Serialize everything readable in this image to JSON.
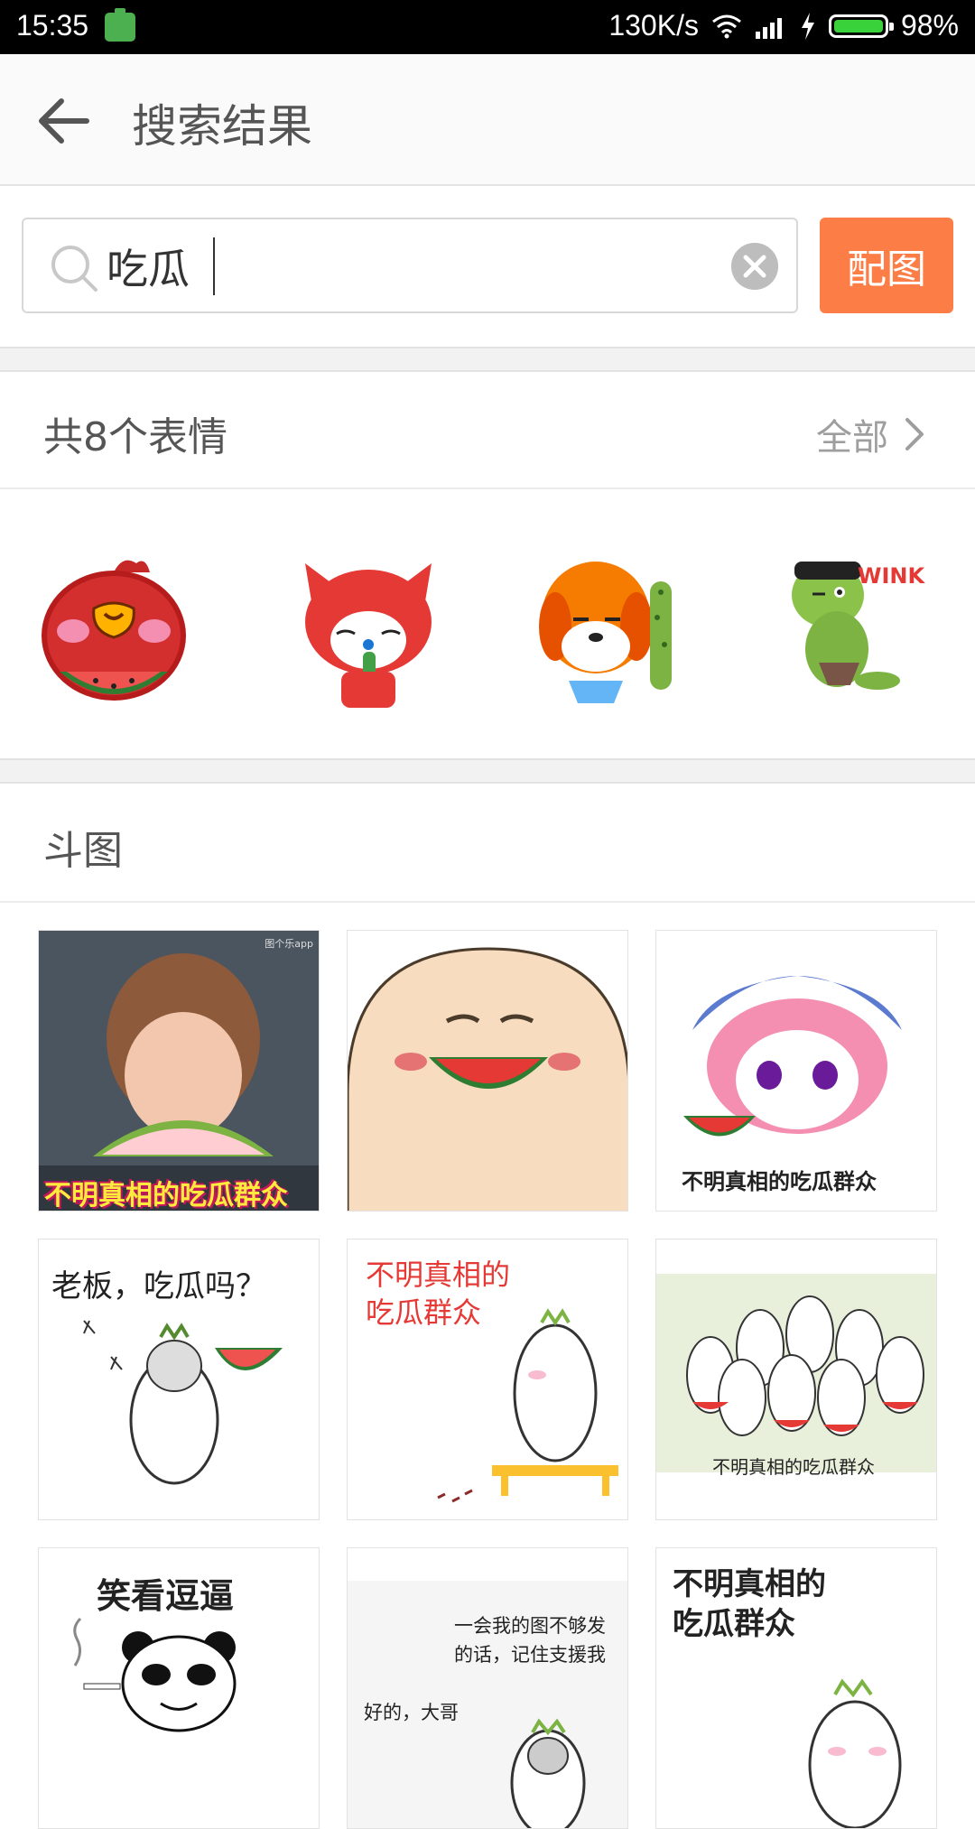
{
  "status_bar": {
    "time": "15:35",
    "net_speed": "130K/s",
    "battery": "98%",
    "icons": [
      "battery-saver-icon",
      "wifi-icon",
      "signal-icon",
      "charging-icon",
      "battery-icon"
    ]
  },
  "header": {
    "back_icon": "arrow-left-icon",
    "title": "搜索结果"
  },
  "search": {
    "value": "吃瓜",
    "icon": "search-icon",
    "clear_icon": "clear-icon",
    "button_label": "配图",
    "button_color": "#fd7d47"
  },
  "emoticons": {
    "title": "共8个表情",
    "see_all": "全部",
    "items": [
      {
        "name": "red-bird-watermelon"
      },
      {
        "name": "red-fox-drinking"
      },
      {
        "name": "orange-dog-cucumber"
      },
      {
        "name": "green-ogre-wink",
        "text": "WINK"
      }
    ]
  },
  "doutu": {
    "title": "斗图",
    "tiles": [
      {
        "name": "girl-eating-watermelon",
        "caption": "不明真相的吃瓜群众",
        "watermark": "图个乐app"
      },
      {
        "name": "egg-face-watermelon"
      },
      {
        "name": "anime-girl-watermelon",
        "caption": "不明真相的吃瓜群众"
      },
      {
        "name": "radish-boss-watermelon",
        "caption": "老板，吃瓜吗？"
      },
      {
        "name": "radish-sitting-bench",
        "caption_line1": "不明真相的",
        "caption_line2": "吃瓜群众"
      },
      {
        "name": "radish-crowd",
        "caption": "不明真相的吃瓜群众"
      },
      {
        "name": "panda-smoking",
        "caption": "笑看逗逼"
      },
      {
        "name": "radish-support",
        "caption_line1": "一会我的图不够发",
        "caption_line2": "的话，记住支援我",
        "caption_line3": "好的，大哥"
      },
      {
        "name": "radish-crowd-2",
        "caption_line1": "不明真相的",
        "caption_line2": "吃瓜群众"
      }
    ]
  }
}
